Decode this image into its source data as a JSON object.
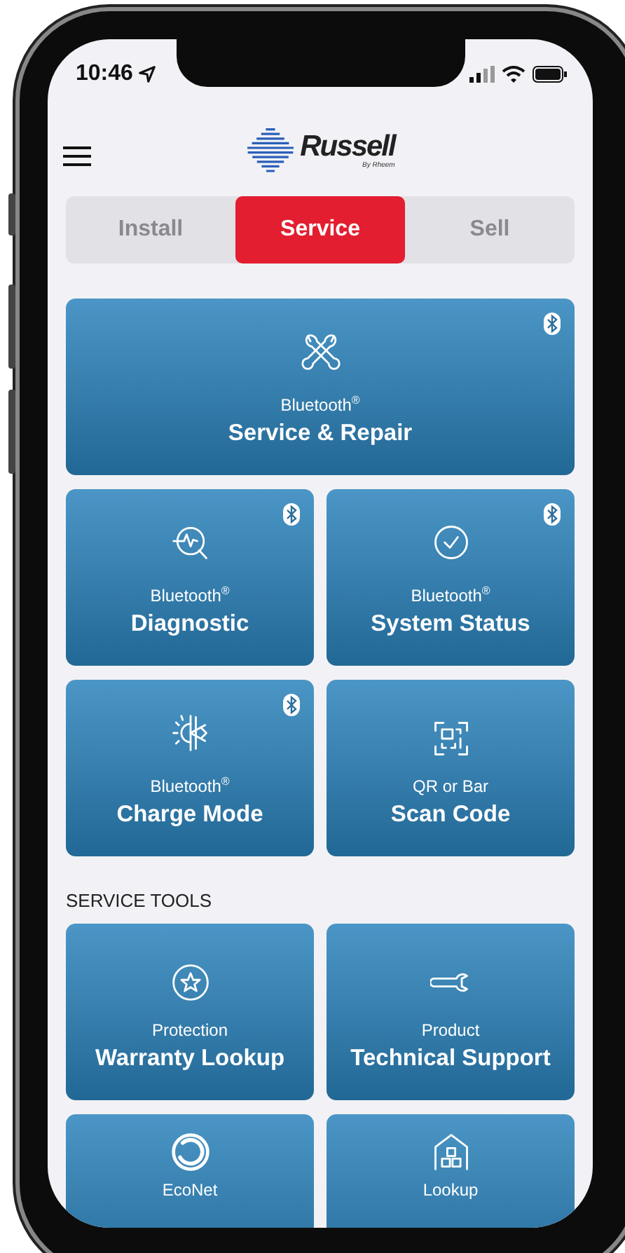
{
  "status_bar": {
    "time": "10:46"
  },
  "header": {
    "logo_text": "Russell",
    "logo_subtext": "By Rheem"
  },
  "tabs": [
    {
      "label": "Install",
      "selected": false
    },
    {
      "label": "Service",
      "selected": true
    },
    {
      "label": "Sell",
      "selected": false
    }
  ],
  "tiles": [
    {
      "kind": "wide",
      "subtitle": "Bluetooth$^{®}$",
      "title": "Service & Repair",
      "bluetooth": true
    },
    {
      "kind": "normal",
      "subtitle": "Bluetooth$^{®}$",
      "title": "Diagnostic",
      "bluetooth": true
    },
    {
      "kind": "normal",
      "subtitle": "Bluetooth$^{®}$",
      "title": "System Status",
      "bluetooth": true
    },
    {
      "kind": "normal",
      "subtitle": "Bluetooth$^{®}$",
      "title": "Charge Mode",
      "bluetooth": true
    },
    {
      "kind": "normal",
      "subtitle": "QR or Bar",
      "title": "Scan Code",
      "bluetooth": false
    }
  ],
  "section_heading": "SERVICE TOOLS",
  "tools": [
    {
      "subtitle": "Protection",
      "title": "Warranty Lookup"
    },
    {
      "subtitle": "Product",
      "title": "Technical Support"
    },
    {
      "subtitle": "EcoNet"
    },
    {
      "subtitle": "Lookup"
    }
  ]
}
